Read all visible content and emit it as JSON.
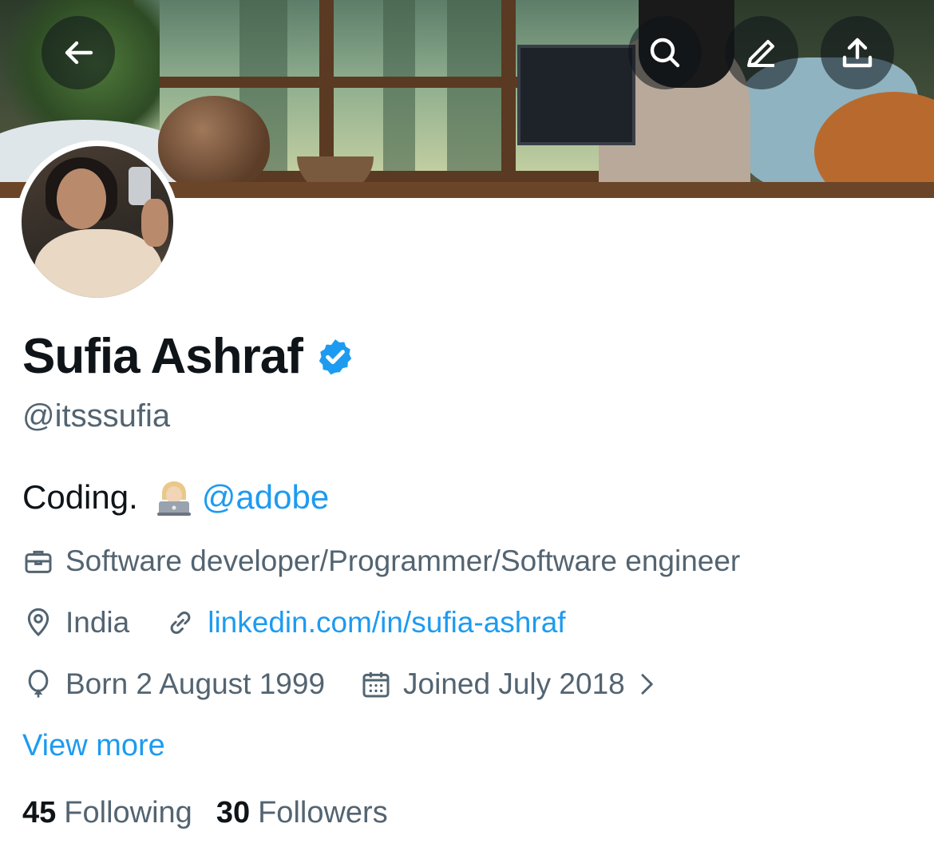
{
  "header": {
    "back_icon": "arrow-left-icon",
    "search_icon": "search-icon",
    "edit_icon": "pencil-icon",
    "share_icon": "share-upload-icon"
  },
  "profile": {
    "name": "Sufia Ashraf",
    "verified_icon": "verified-badge-icon",
    "verified_color": "#1d9bf0",
    "handle": "@itsssufia",
    "bio_text": "Coding.",
    "bio_emoji": "woman-technologist-emoji",
    "bio_mention": "@adobe",
    "profession": "Software developer/Programmer/Software engineer",
    "location": "India",
    "website": "linkedin.com/in/sufia-ashraf",
    "birthday": "Born 2 August 1999",
    "joined": "Joined July 2018",
    "view_more": "View more"
  },
  "stats": {
    "following_count": "45",
    "following_label": "Following",
    "followers_count": "30",
    "followers_label": "Followers"
  },
  "colors": {
    "accent": "#1d9bf0",
    "secondary_text": "#536471",
    "primary_text": "#0f1419"
  }
}
